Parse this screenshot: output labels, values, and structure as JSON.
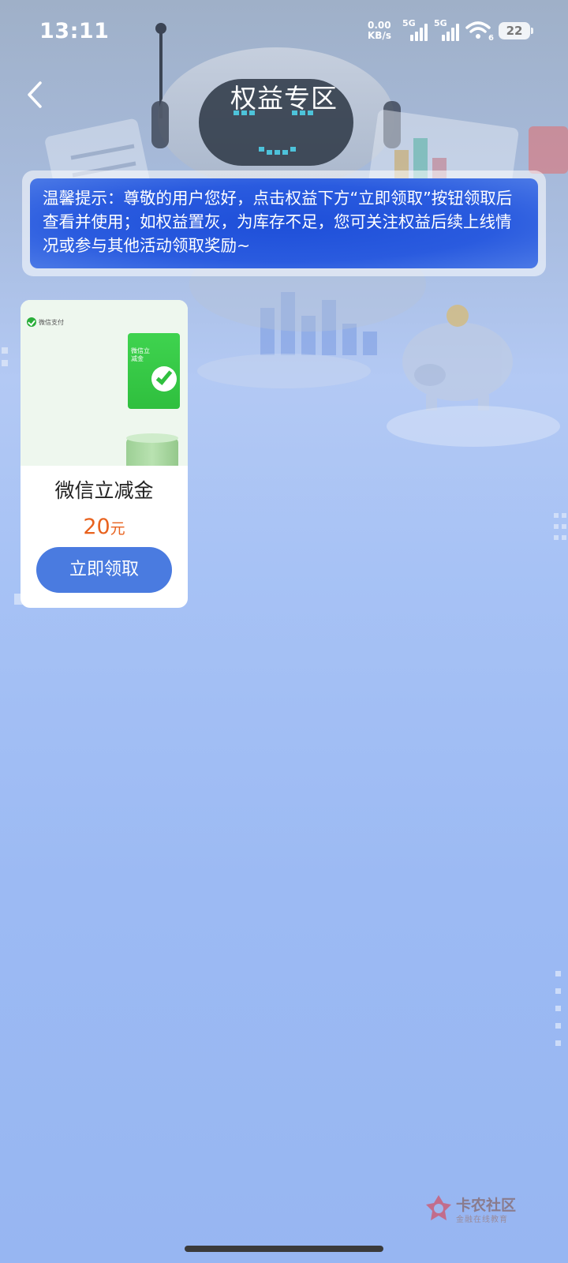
{
  "status_bar": {
    "time": "13:11",
    "net_speed_value": "0.00",
    "net_speed_unit": "KB/s",
    "sim1_tag": "5G",
    "sim2_tag": "5G",
    "wifi_sub": "6",
    "battery": "22"
  },
  "nav": {
    "back_icon": "chevron-left-icon",
    "title": "权益专区"
  },
  "tip": {
    "text": "温馨提示：尊敬的用户您好，点击权益下方“立即领取”按钮领取后查看并使用；如权益置灰，为库存不足，您可关注权益后续上线情况或参与其他活动领取奖励~"
  },
  "benefits": [
    {
      "image_brand_label": "微信支付",
      "image_card_label": "微信立减金",
      "name": "微信立减金",
      "price_value": "20",
      "price_unit": "元",
      "claim_label": "立即领取"
    }
  ],
  "watermark": {
    "main": "卡农社区",
    "sub": "金融在线教育"
  },
  "colors": {
    "accent_button": "#4a7be0",
    "price": "#e8621e",
    "tip_bg": "#2a5bdf"
  }
}
